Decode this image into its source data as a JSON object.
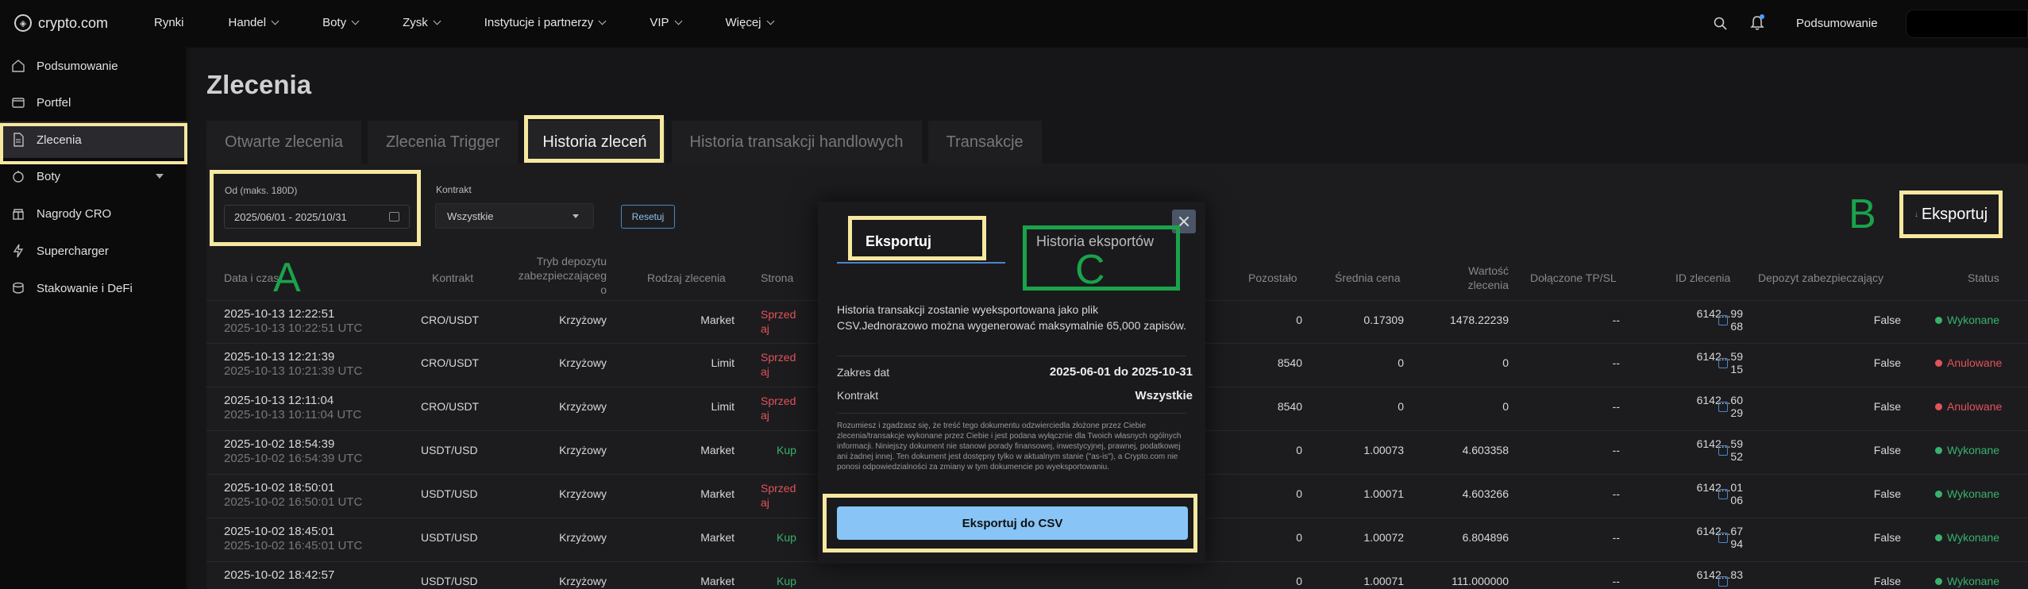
{
  "topbar": {
    "logo_text": "crypto.com",
    "logo_icon": "crypto-com-lion-icon",
    "nav": [
      {
        "label": "Rynki",
        "has_dropdown": false
      },
      {
        "label": "Handel",
        "has_dropdown": true
      },
      {
        "label": "Boty",
        "has_dropdown": true
      },
      {
        "label": "Zysk",
        "has_dropdown": true
      },
      {
        "label": "Instytucje i partnerzy",
        "has_dropdown": true
      },
      {
        "label": "VIP",
        "has_dropdown": true
      },
      {
        "label": "Więcej",
        "has_dropdown": true
      }
    ],
    "summary_label": "Podsumowanie"
  },
  "sidebar": {
    "items": [
      {
        "label": "Podsumowanie",
        "icon": "home-icon",
        "active": false
      },
      {
        "label": "Portfel",
        "icon": "wallet-icon",
        "active": false
      },
      {
        "label": "Zlecenia",
        "icon": "document-icon",
        "active": true
      },
      {
        "label": "Boty",
        "icon": "bot-icon",
        "active": false,
        "expandable": true
      },
      {
        "label": "Nagrody CRO",
        "icon": "reward-icon",
        "active": false
      },
      {
        "label": "Supercharger",
        "icon": "lightning-icon",
        "active": false
      },
      {
        "label": "Stakowanie i DeFi",
        "icon": "stack-coins-icon",
        "active": false
      }
    ]
  },
  "page": {
    "title": "Zlecenia",
    "tabs": [
      {
        "label": "Otwarte zlecenia",
        "active": false
      },
      {
        "label": "Zlecenia Trigger",
        "active": false
      },
      {
        "label": "Historia zleceń",
        "active": true
      },
      {
        "label": "Historia transakcji handlowych",
        "active": false
      },
      {
        "label": "Transakcje",
        "active": false
      }
    ]
  },
  "filters": {
    "date_label": "Od (maks. 180D)",
    "date_value": "2025/06/01 - 2025/10/31",
    "contract_label": "Kontrakt",
    "contract_value": "Wszystkie",
    "reset_label": "Resetuj",
    "export_label": "Eksportuj"
  },
  "table": {
    "headers": {
      "datetime": "Data i czas",
      "contract": "Kontrakt",
      "margin_mode": [
        "Tryb depozytu",
        "zabezpieczająceg",
        "o"
      ],
      "order_type": "Rodzaj zlecenia",
      "side": "Strona",
      "remaining": "Pozostało",
      "avg_price": "Średnia cena",
      "order_value": [
        "Wartość",
        "zlecenia"
      ],
      "tp_sl": "Dołączone TP/SL",
      "order_id": "ID zlecenia",
      "margin_deposit": "Depozyt zabezpieczający",
      "status": "Status"
    },
    "rows": [
      {
        "date": "2025-10-13 12:22:51",
        "date_utc": "2025-10-13 10:22:51 UTC",
        "contract": "CRO/USDT",
        "margin": "Krzyżowy",
        "type": "Market",
        "side": "Sprzedaj",
        "side_kind": "sell",
        "remaining": "0",
        "avg": "0.17309",
        "value": "1478.22239",
        "tpsl": "--",
        "id1": "6142...99",
        "id2": "68",
        "deposit": "False",
        "status": "Wykonane",
        "status_kind": "ok"
      },
      {
        "date": "2025-10-13 12:21:39",
        "date_utc": "2025-10-13 10:21:39 UTC",
        "contract": "CRO/USDT",
        "margin": "Krzyżowy",
        "type": "Limit",
        "side": "Sprzedaj",
        "side_kind": "sell",
        "remaining": "8540",
        "avg": "0",
        "value": "0",
        "tpsl": "--",
        "id1": "6142...59",
        "id2": "15",
        "deposit": "False",
        "status": "Anulowane",
        "status_kind": "cancel"
      },
      {
        "date": "2025-10-13 12:11:04",
        "date_utc": "2025-10-13 10:11:04 UTC",
        "contract": "CRO/USDT",
        "margin": "Krzyżowy",
        "type": "Limit",
        "side": "Sprzedaj",
        "side_kind": "sell",
        "remaining": "8540",
        "avg": "0",
        "value": "0",
        "tpsl": "--",
        "id1": "6142...60",
        "id2": "29",
        "deposit": "False",
        "status": "Anulowane",
        "status_kind": "cancel"
      },
      {
        "date": "2025-10-02 18:54:39",
        "date_utc": "2025-10-02 16:54:39 UTC",
        "contract": "USDT/USD",
        "margin": "Krzyżowy",
        "type": "Market",
        "side": "Kup",
        "side_kind": "buy",
        "remaining": "0",
        "avg": "1.00073",
        "value": "4.603358",
        "tpsl": "--",
        "id1": "6142...59",
        "id2": "52",
        "deposit": "False",
        "status": "Wykonane",
        "status_kind": "ok"
      },
      {
        "date": "2025-10-02 18:50:01",
        "date_utc": "2025-10-02 16:50:01 UTC",
        "contract": "USDT/USD",
        "margin": "Krzyżowy",
        "type": "Market",
        "side": "Sprzedaj",
        "side_kind": "sell",
        "remaining": "0",
        "avg": "1.00071",
        "value": "4.603266",
        "tpsl": "--",
        "id1": "6142...01",
        "id2": "06",
        "deposit": "False",
        "status": "Wykonane",
        "status_kind": "ok"
      },
      {
        "date": "2025-10-02 18:45:01",
        "date_utc": "2025-10-02 16:45:01 UTC",
        "contract": "USDT/USD",
        "margin": "Krzyżowy",
        "type": "Market",
        "side": "Kup",
        "side_kind": "buy",
        "remaining": "0",
        "avg": "1.00072",
        "value": "6.804896",
        "tpsl": "--",
        "id1": "6142...67",
        "id2": "94",
        "deposit": "False",
        "status": "Wykonane",
        "status_kind": "ok"
      },
      {
        "date": "2025-10-02 18:42:57",
        "date_utc": "",
        "contract": "USDT/USD",
        "margin": "Krzyżowy",
        "type": "Market",
        "side": "Kup",
        "side_kind": "buy",
        "remaining": "0",
        "avg": "1.00071",
        "value": "111.000000",
        "tpsl": "--",
        "id1": "6142...83",
        "id2": "",
        "deposit": "False",
        "status": "Wykonane",
        "status_kind": "ok"
      }
    ]
  },
  "modal": {
    "tab_export": "Eksportuj",
    "tab_history": "Historia eksportów",
    "description": "Historia transakcji zostanie wyeksportowana jako plik CSV.Jednorazowo można wygenerować maksymalnie 65,000 zapisów.",
    "date_range_label": "Zakres dat",
    "date_range_value": "2025-06-01 do 2025-10-31",
    "contract_label": "Kontrakt",
    "contract_value": "Wszystkie",
    "legal": "Rozumiesz i zgadzasz się, że treść tego dokumentu odzwierciedla złożone przez Ciebie zlecenia/transakcje wykonane przez Ciebie i jest podana wyłącznie dla Twoich własnych ogólnych informacji. Niniejszy dokument nie stanowi porady finansowej, inwestycyjnej, prawnej, podatkowej ani żadnej innej. Ten dokument jest dostępny tylko w aktualnym stanie (\"as-is\"), a Crypto.com nie ponosi odpowiedzialności za zmiany w tym dokumencie po wyeksportowaniu.",
    "csv_button": "Eksportuj do CSV"
  },
  "annotations": {
    "letter_a": "A",
    "letter_b": "B",
    "letter_c": "C",
    "highlight_color": "#f7e8a0",
    "letter_color": "#1aa34a"
  }
}
